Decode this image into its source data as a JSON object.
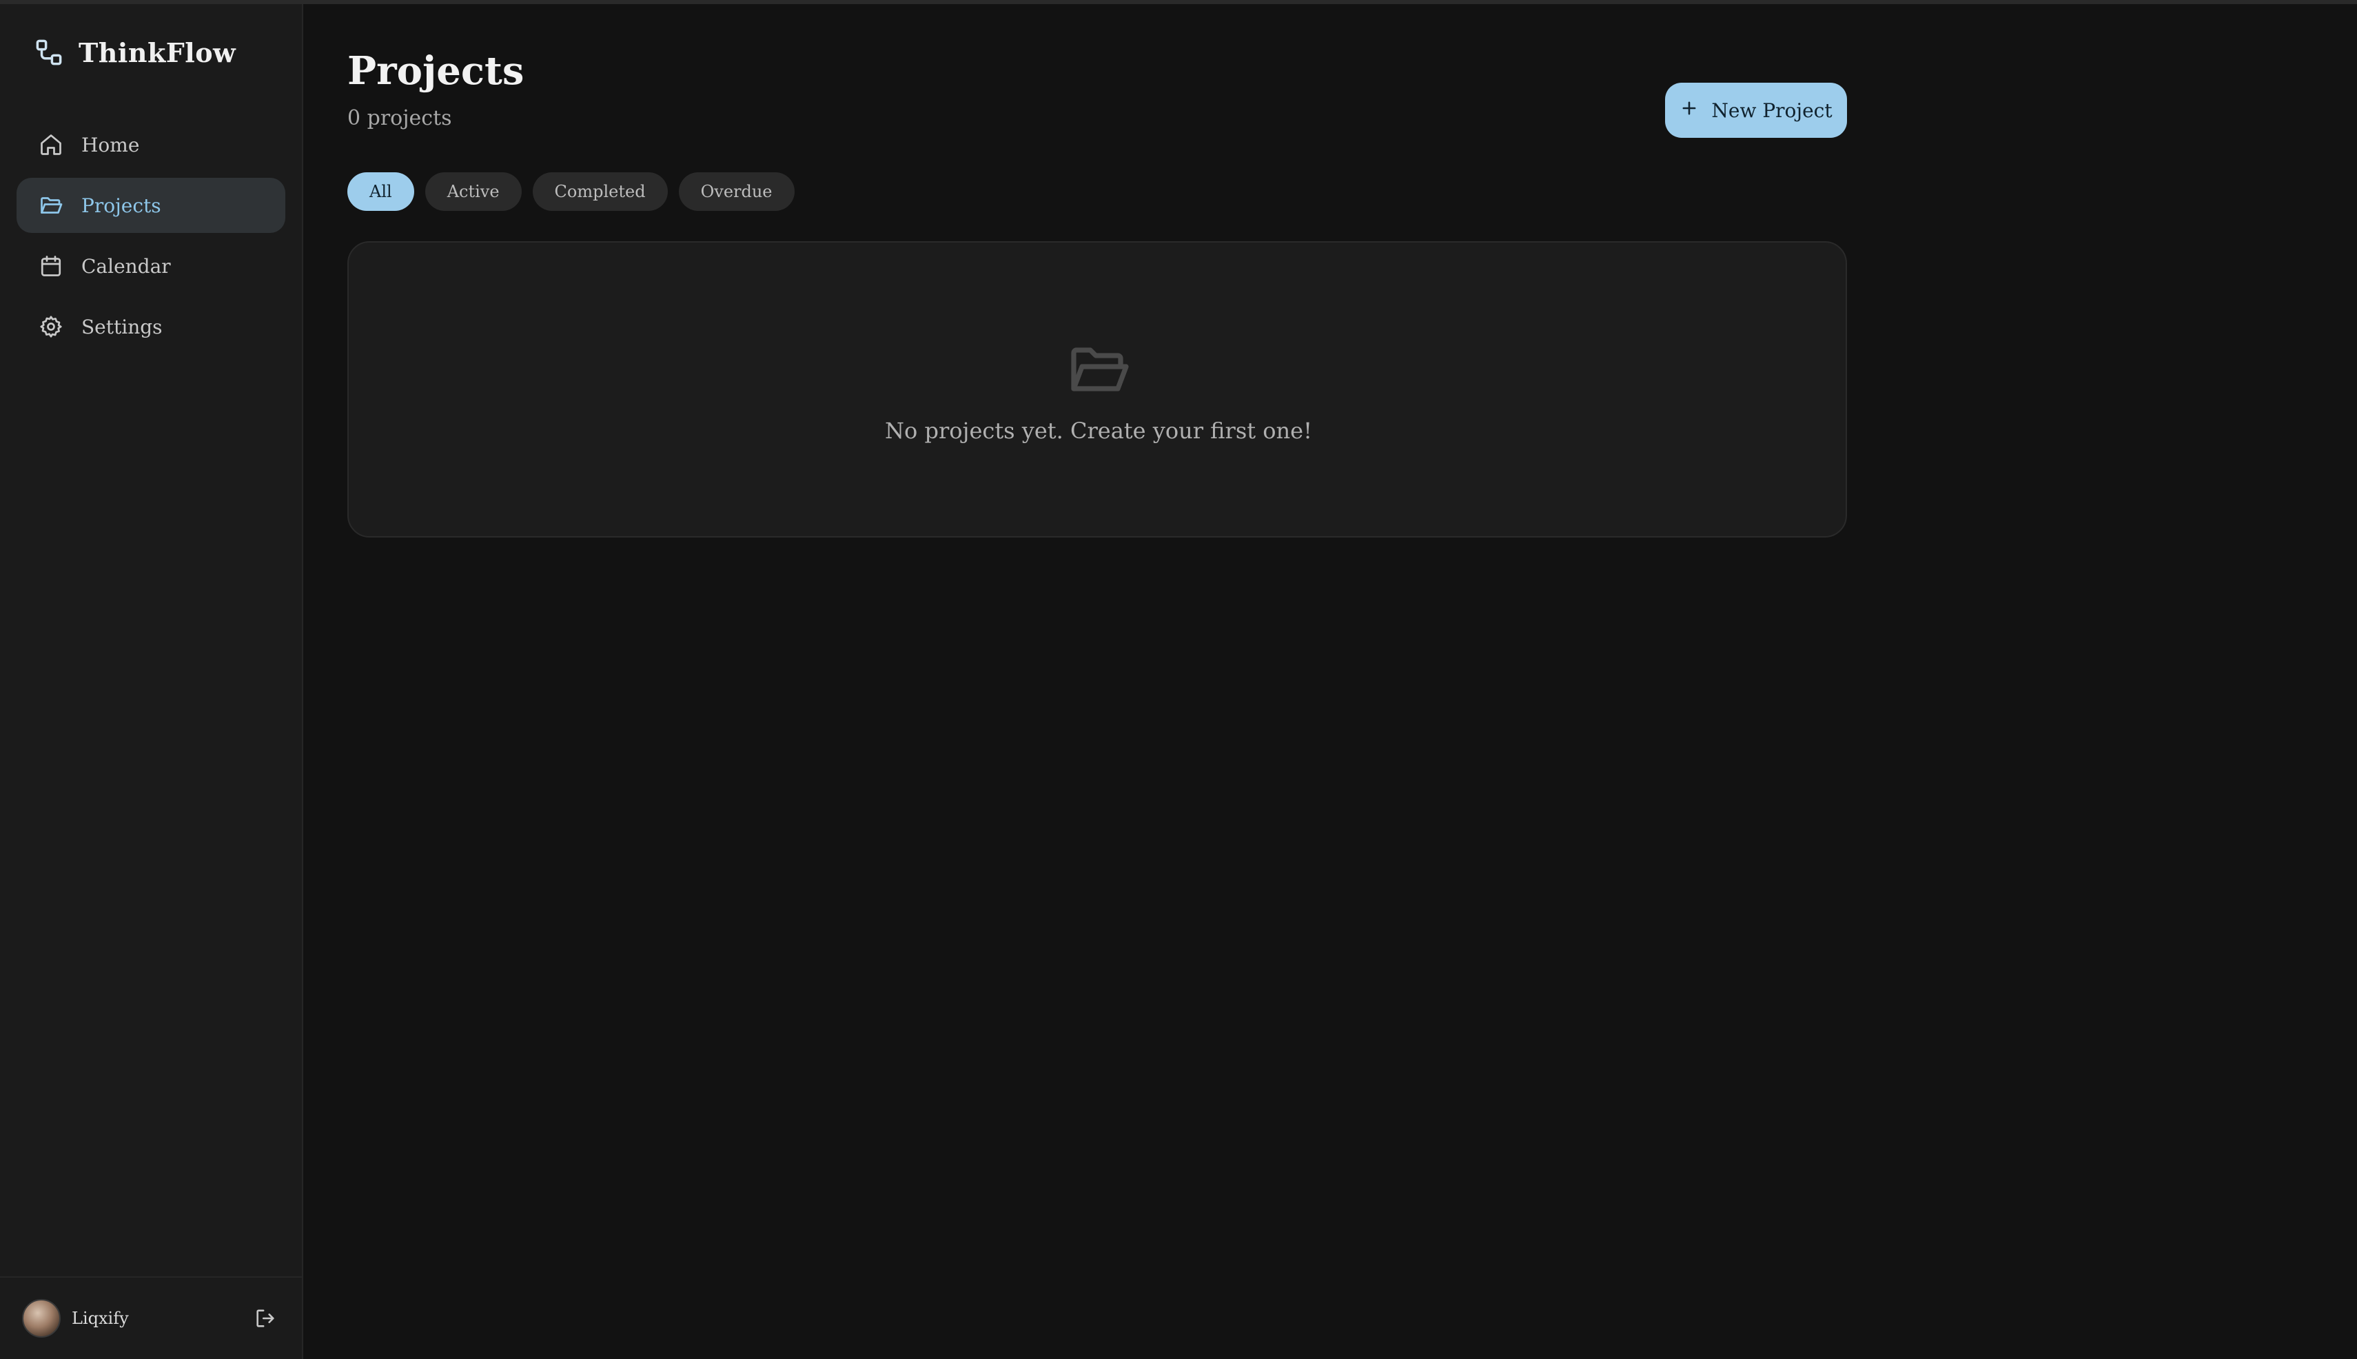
{
  "app": {
    "name": "ThinkFlow"
  },
  "sidebar": {
    "items": [
      {
        "label": "Home",
        "icon": "home-icon",
        "active": false
      },
      {
        "label": "Projects",
        "icon": "folder-open-icon",
        "active": true
      },
      {
        "label": "Calendar",
        "icon": "calendar-icon",
        "active": false
      },
      {
        "label": "Settings",
        "icon": "gear-icon",
        "active": false
      }
    ],
    "user": {
      "name": "Liqxify",
      "logout_icon": "logout-icon"
    }
  },
  "main": {
    "title": "Projects",
    "count_text": "0 projects",
    "new_button_label": "New Project",
    "filters": [
      {
        "label": "All",
        "active": true
      },
      {
        "label": "Active",
        "active": false
      },
      {
        "label": "Completed",
        "active": false
      },
      {
        "label": "Overdue",
        "active": false
      }
    ],
    "empty_state": {
      "icon": "folder-open-icon",
      "message": "No projects yet. Create your first one!"
    }
  },
  "colors": {
    "accent": "#9dcdec",
    "active_nav_text": "#8ec7ea",
    "background": "#121212",
    "sidebar": "#1b1b1b",
    "card": "#1c1c1c"
  }
}
